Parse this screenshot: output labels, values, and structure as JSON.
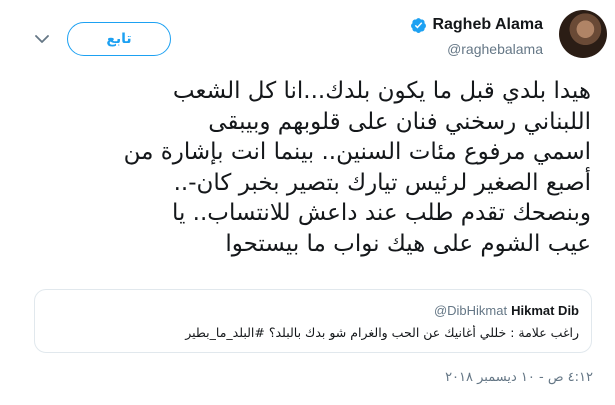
{
  "header": {
    "display_name": "Ragheb Alama",
    "handle": "@raghebalama",
    "follow_label": "تابع"
  },
  "tweet": {
    "text": "هيدا بلدي قبل ما يكون بلدك...انا كل  الشعب\nاللبناني رسخني فنان على قلوبهم وبيبقى\nاسمي مرفوع مئات السنين.. بينما انت بإشارة من\nأصبع الصغير لرئيس تيارك بتصير بخبر كان-..\nوبنصحك تقدم طلب عند داعش للانتساب.. يا\nعيب الشوم على هيك نواب ما بيستحوا",
    "timestamp": "٤:١٢ ص - ١٠ ديسمبر ٢٠١٨"
  },
  "quote": {
    "name": "Hikmat Dib",
    "handle": "@DibHikmat",
    "text": "راغب علامة : خللي أغانيك عن الحب والغرام شو بدك بالبلد؟ #البلد_ما_بطير"
  },
  "colors": {
    "accent": "#1da1f2",
    "text": "#14171a",
    "muted": "#657786",
    "border": "#e1e8ed"
  },
  "icons": {
    "menu": "chevron-down-icon",
    "verified": "verified-badge-icon"
  }
}
